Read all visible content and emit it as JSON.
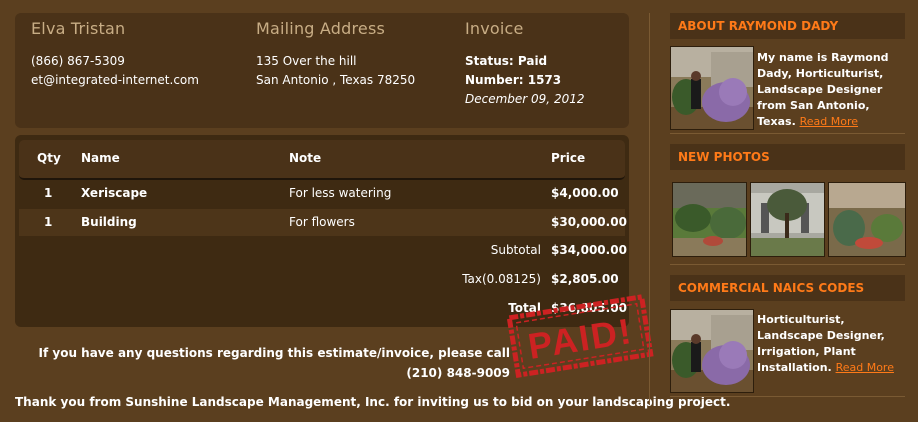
{
  "client": {
    "name": "Elva Tristan",
    "phone": "(866) 867-5309",
    "email": "et@integrated-internet.com"
  },
  "mailing": {
    "heading": "Mailing Address",
    "street": "135 Over the hill",
    "city": "San Antonio , Texas 78250"
  },
  "invoice": {
    "heading": "Invoice",
    "status": "Status: Paid",
    "number": "Number: 1573",
    "date": "December 09, 2012"
  },
  "table": {
    "headers": [
      "Qty",
      "Name",
      "Note",
      "Price"
    ],
    "rows": [
      {
        "qty": "1",
        "name": "Xeriscape",
        "note": "For less watering",
        "price": "$4,000.00"
      },
      {
        "qty": "1",
        "name": "Building",
        "note": "For flowers",
        "price": "$30,000.00"
      }
    ],
    "subtotal_label": "Subtotal",
    "subtotal": "$34,000.00",
    "tax_label": "Tax(0.08125)",
    "tax": "$2,805.00",
    "total_label": "Total",
    "total": "$36,805.00"
  },
  "stamp": {
    "text": "PAID!",
    "color": "#cc2222"
  },
  "footer": {
    "question": "If you have any questions regarding this estimate/invoice, please call (210) 848-9009",
    "thanks": "Thank you from Sunshine Landscape Management, Inc. for inviting us to bid on your landscaping project."
  },
  "sidebar": {
    "about": {
      "title": "ABOUT RAYMOND DADY",
      "text": "My name is Raymond Dady, Horticulturist, Landscape Designer from San Antonio, Texas.",
      "link": "Read More"
    },
    "photos": {
      "title": "NEW PHOTOS"
    },
    "naics": {
      "title": "COMMERCIAL NAICS CODES",
      "text": "Horticulturist, Landscape Designer, Irrigation, Plant Installation.",
      "link": "Read More"
    }
  },
  "colors": {
    "background": "#5b3f1f",
    "panel": "#4a3218",
    "accent": "#ff7a18",
    "heading": "#c8ad85"
  }
}
